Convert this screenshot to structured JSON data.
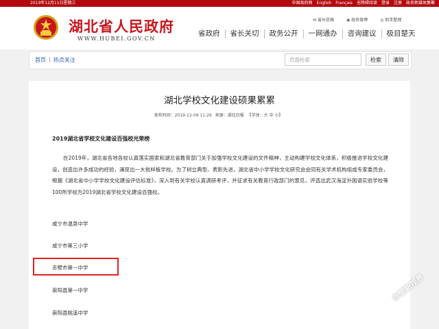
{
  "topbar": {
    "date": "2019年12月11日星期三",
    "links": [
      "中国政府网",
      "English",
      "Français",
      "无障碍阅读",
      "登录",
      "注册",
      "政务新媒体集聚"
    ]
  },
  "header": {
    "title": "湖北省人民政府",
    "url": "WWW.HUBEI.GOV.CN",
    "utils": [
      "省长信箱",
      "政务微博",
      "助手整理"
    ],
    "nav": [
      "省政府",
      "省长关切",
      "政务公开",
      "一网通办",
      "咨询建议",
      "极目楚天"
    ]
  },
  "breadcrumb": {
    "home": "首页",
    "sep": "|",
    "current": "热点关注"
  },
  "search": {
    "placeholder": "页面检索",
    "search_label": "检索",
    "clear_label": "清除"
  },
  "article": {
    "title": "湖北学校文化建设硕果累累",
    "publish_time": "发布时间：2019-12-09 11:26",
    "source": "来源：湖北日报",
    "font_size_label": "【字体：大  中  小】",
    "subtitle": "2019湖北省学校文化建设百强校光荣榜",
    "paragraph": "在2019年，湖北省各地各校认真落实国家和湖北省教育部门关于加强学校文化建设的文件精神，主动构建学校文化体系，积极推进学校文化建设，创造出许多成功的经验，涌现出一大批样板学校。为了树立典型、表彰先进，湖北省中小学学校文化研究会会同有关学术机构组成专家委员会，根据《湖北省中小学学校文化建设评估标准》，深入到有关学校认真调研考评，并征求有关教育行政部门的意见，评选出武汉海淀外国语实验学校等100所学校为2019湖北省学校文化建设百强校。",
    "schools": [
      "咸宁市温泉中学",
      "咸宁市第三小学",
      "赤壁市第一中学",
      "崇阳县第一中学",
      "崇阳县桃溪中学"
    ]
  },
  "watermark": {
    "text": "赤壁新视界"
  },
  "colors": {
    "brand_red": "#b3080e",
    "title_red": "#c8161d",
    "highlight": "#e02020",
    "link_blue": "#2a60b0"
  }
}
